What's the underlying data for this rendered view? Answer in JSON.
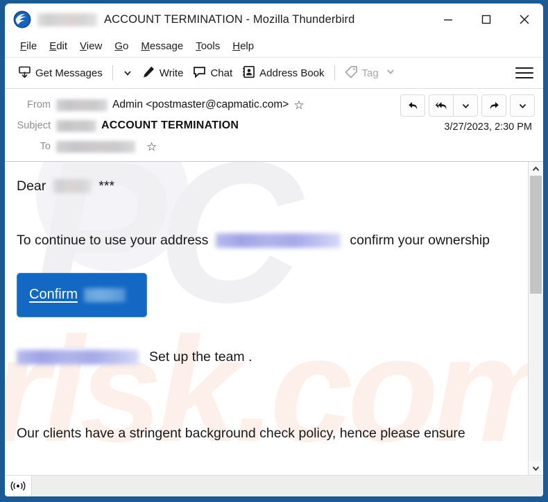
{
  "window": {
    "title_suffix": "ACCOUNT TERMINATION - Mozilla Thunderbird",
    "app_icon": "thunderbird-icon",
    "controls": {
      "minimize": "minimize-icon",
      "maximize": "maximize-icon",
      "close": "close-icon"
    }
  },
  "menubar": {
    "items": [
      {
        "pre": "",
        "accel": "F",
        "post": "ile"
      },
      {
        "pre": "",
        "accel": "E",
        "post": "dit"
      },
      {
        "pre": "",
        "accel": "V",
        "post": "iew"
      },
      {
        "pre": "",
        "accel": "G",
        "post": "o"
      },
      {
        "pre": "",
        "accel": "M",
        "post": "essage"
      },
      {
        "pre": "",
        "accel": "T",
        "post": "ools"
      },
      {
        "pre": "",
        "accel": "H",
        "post": "elp"
      }
    ]
  },
  "toolbar": {
    "get_messages": "Get Messages",
    "write": "Write",
    "chat": "Chat",
    "address_book": "Address Book",
    "tag": "Tag",
    "app_menu": "app-menu-icon"
  },
  "message_header": {
    "from_label": "From",
    "from_value": "Admin <postmaster@capmatic.com>",
    "subject_label": "Subject",
    "subject_value": "ACCOUNT TERMINATION",
    "to_label": "To",
    "date": "3/27/2023, 2:30 PM",
    "actions": {
      "reply": "reply-icon",
      "reply_all": "reply-all-icon",
      "reply_menu": "chevron-down-icon",
      "forward": "forward-icon",
      "more_menu": "chevron-down-icon"
    }
  },
  "body": {
    "greeting_prefix": "Dear",
    "greeting_suffix": "***",
    "line2_part1": "To  continue to use your address",
    "line2_part2": "confirm your ownership",
    "confirm_button_label": "Confirm",
    "line3": "Set up the team .",
    "line4": "Our clients have a stringent background check policy, hence please ensure",
    "watermark_top": "PC",
    "watermark_bottom": "risk.com"
  },
  "statusbar": {
    "connection_icon": "connection-status-icon"
  },
  "colors": {
    "frame": "#1a5a96",
    "confirm_button": "#1268c3",
    "link_redaction": "#a5a9e8",
    "watermark_grey": "#f0f0f2",
    "watermark_orange": "#fdf0ea"
  }
}
